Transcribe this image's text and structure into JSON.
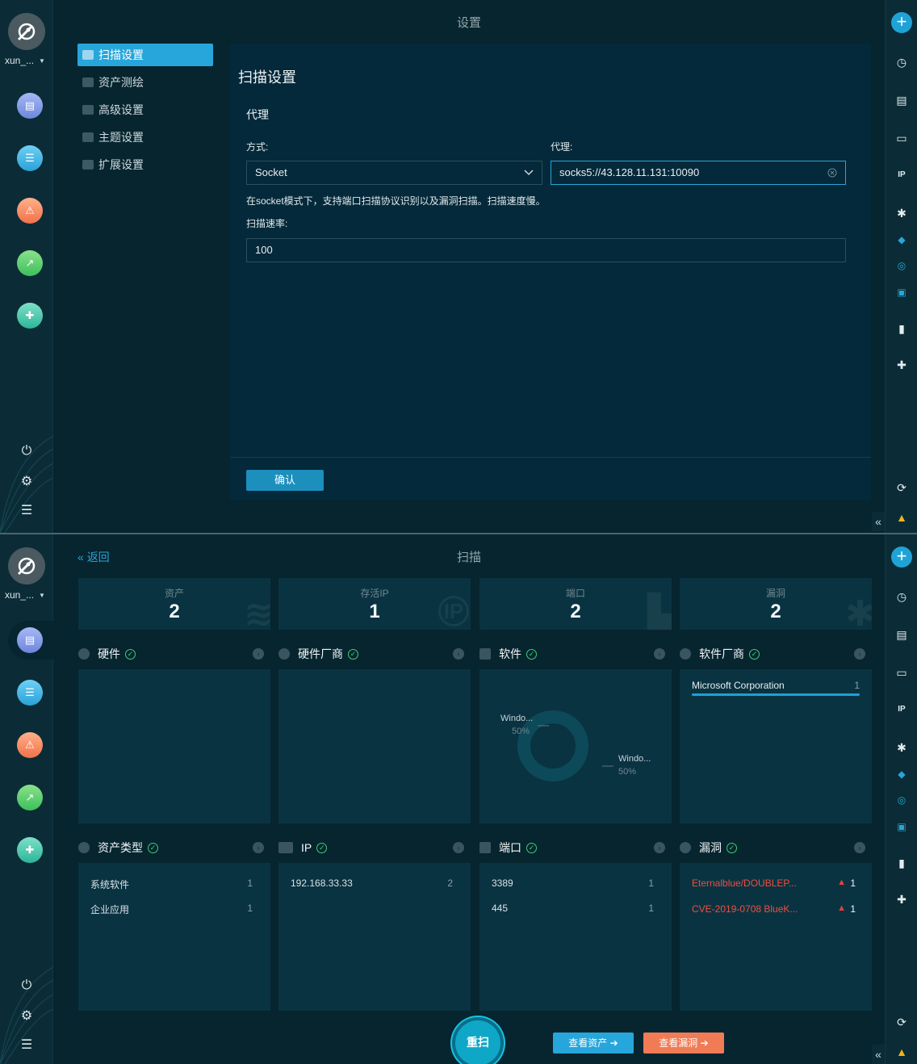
{
  "user": {
    "name": "xun_..."
  },
  "settings": {
    "page_title": "设置",
    "menu": [
      "扫描设置",
      "资产测绘",
      "高级设置",
      "主题设置",
      "扩展设置"
    ],
    "panel_title": "扫描设置",
    "section": "代理",
    "mode_label": "方式:",
    "mode_value": "Socket",
    "proxy_label": "代理:",
    "proxy_value": "socks5://43.128.11.131:10090",
    "hint": "在socket模式下，支持端口扫描协议识别以及漏洞扫描。扫描速度慢。",
    "rate_label": "扫描速率:",
    "rate_value": "100",
    "confirm": "确认"
  },
  "scan": {
    "page_title": "扫描",
    "back": "返回",
    "stats": [
      {
        "label": "资产",
        "value": "2"
      },
      {
        "label": "存活IP",
        "value": "1"
      },
      {
        "label": "端口",
        "value": "2"
      },
      {
        "label": "漏洞",
        "value": "2"
      }
    ],
    "sections_top": [
      "硬件",
      "硬件厂商",
      "软件",
      "软件厂商"
    ],
    "software_chart": {
      "slices": [
        {
          "label": "Windo...",
          "pct": "50%",
          "value": 50
        },
        {
          "label": "Windo...",
          "pct": "50%",
          "value": 50
        }
      ]
    },
    "software_vendor": {
      "name": "Microsoft Corporation",
      "count": "1"
    },
    "sections_bottom": [
      "资产类型",
      "IP",
      "端口",
      "漏洞"
    ],
    "asset_types": [
      {
        "name": "系统软件",
        "count": "1"
      },
      {
        "name": "企业应用",
        "count": "1"
      }
    ],
    "ips": [
      {
        "name": "192.168.33.33",
        "count": "2"
      }
    ],
    "ports": [
      {
        "name": "3389",
        "count": "1"
      },
      {
        "name": "445",
        "count": "1"
      }
    ],
    "vulns": [
      {
        "name": "Eternalblue/DOUBLEP...",
        "count": "1"
      },
      {
        "name": "CVE-2019-0708 BlueK...",
        "count": "1"
      }
    ],
    "rescan": "重扫",
    "view_assets": "查看资产",
    "view_vulns": "查看漏洞"
  }
}
